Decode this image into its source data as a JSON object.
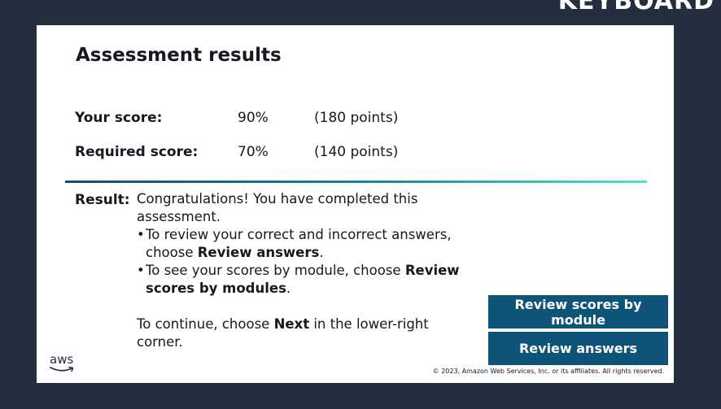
{
  "corner_label": "KEYBOARD",
  "title": "Assessment results",
  "scores": [
    {
      "label": "Your score:",
      "percent": "90%",
      "points": "(180 points)"
    },
    {
      "label": "Required score:",
      "percent": "70%",
      "points": "(140 points)"
    }
  ],
  "result": {
    "label": "Result:",
    "congrats": "Congratulations! You have completed this assessment.",
    "bullet1_prefix": "To review your correct and incorrect answers, choose ",
    "bullet1_bold": "Review answers",
    "bullet1_suffix": ".",
    "bullet2_prefix": "To see your scores by module, choose ",
    "bullet2_bold": "Review scores by modules",
    "bullet2_suffix": ".",
    "continue_prefix": "To continue, choose ",
    "continue_bold": "Next",
    "continue_suffix": " in the lower-right corner."
  },
  "buttons": {
    "review_modules": "Review scores by module",
    "review_answers": "Review answers"
  },
  "logo_text": "aws",
  "copyright": "© 2023, Amazon Web Services, Inc. or its affiliates. All rights reserved.",
  "colors": {
    "background": "#232f3e",
    "button": "#0d5478",
    "divider_start": "#0d4f6e",
    "divider_end": "#56e1c9",
    "aws_smile": "#232f3e"
  }
}
